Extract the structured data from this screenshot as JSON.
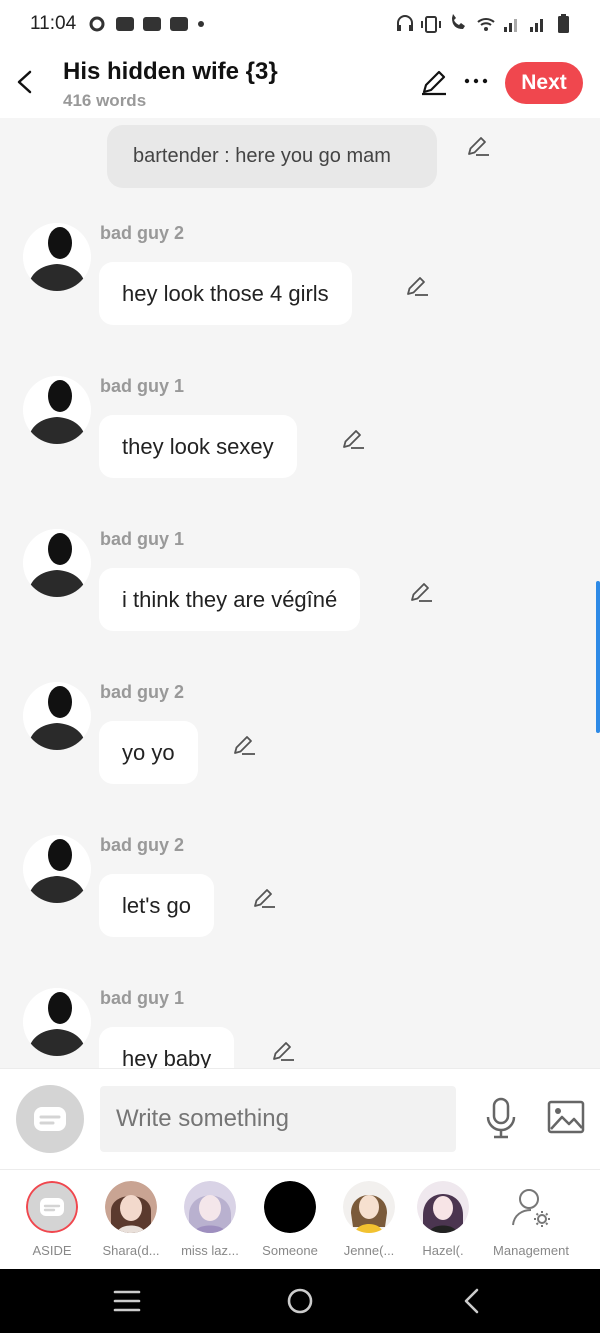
{
  "status": {
    "time": "11:04"
  },
  "header": {
    "title": "His hidden wife {3}",
    "subtitle": "416 words",
    "next_label": "Next"
  },
  "chat": {
    "narration": "bartender : here you go mam",
    "messages": [
      {
        "speaker": "bad guy 2",
        "text": "hey look those 4 girls"
      },
      {
        "speaker": "bad guy 1",
        "text": "they look sexey"
      },
      {
        "speaker": "bad guy 1",
        "text": "i think they are végîné"
      },
      {
        "speaker": "bad guy 2",
        "text": "yo yo"
      },
      {
        "speaker": "bad guy 2",
        "text": "let's go"
      },
      {
        "speaker": "bad guy 1",
        "text": "hey baby"
      }
    ]
  },
  "composer": {
    "placeholder": "Write something"
  },
  "characters": [
    {
      "label": "ASIDE",
      "icon": "aside-icon"
    },
    {
      "label": "Shara(d...",
      "icon": "anime-avatar"
    },
    {
      "label": "miss laz...",
      "icon": "anime-avatar"
    },
    {
      "label": "Someone",
      "icon": "black-avatar"
    },
    {
      "label": "Jenne(...",
      "icon": "anime-avatar"
    },
    {
      "label": "Hazel(.",
      "icon": "anime-avatar"
    },
    {
      "label": "Management",
      "icon": "user-gear-icon"
    }
  ],
  "colors": {
    "accent": "#f0474e",
    "scroll": "#2e8ae6"
  }
}
